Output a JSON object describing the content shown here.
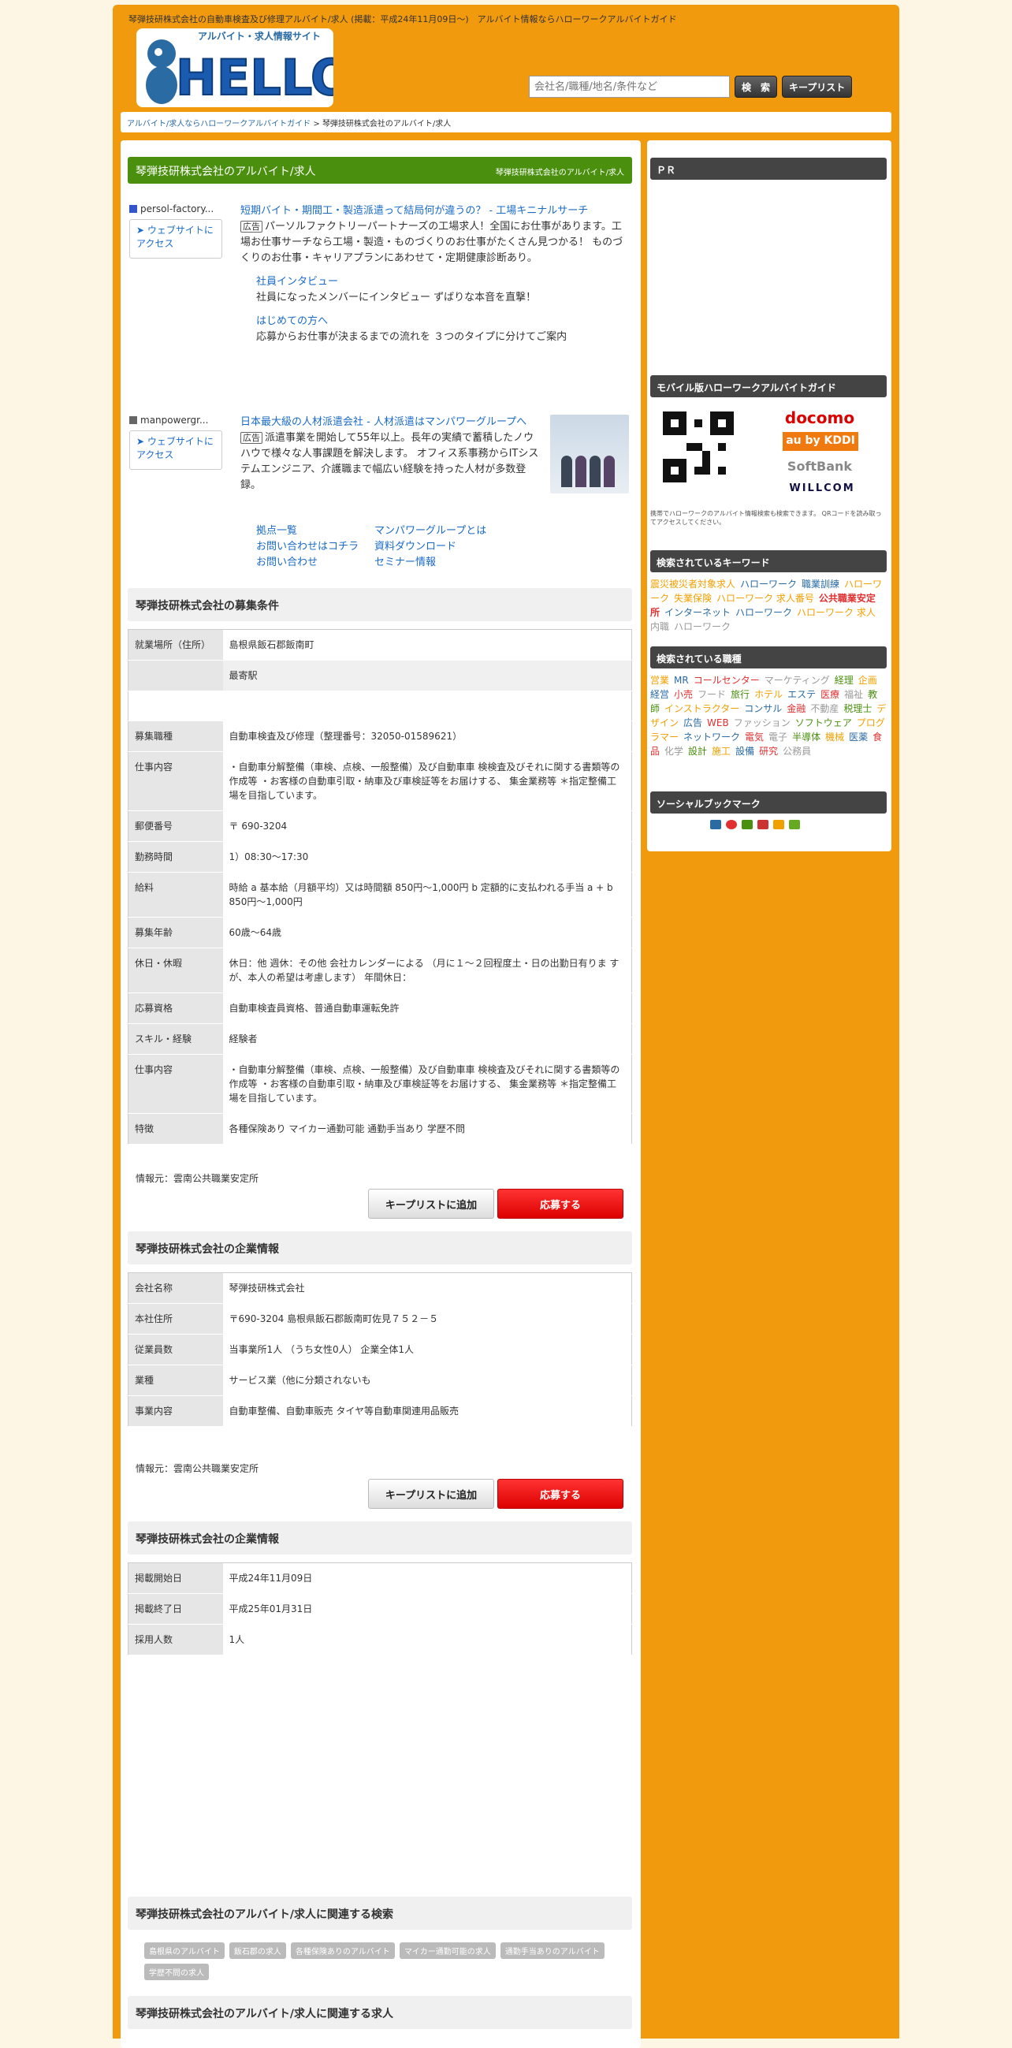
{
  "header": {
    "top_text": "琴弾技研株式会社の自動車検査及び修理アルバイト/求人 (掲載：平成24年11月09日～)　アルバイト情報ならハローワークアルバイトガイド",
    "logo_tagline": "アルバイト・求人情報サイト",
    "logo_text": "HELLO!!",
    "search_placeholder": "会社名/職種/地名/条件など",
    "search_button": "検　索",
    "keeplist_button": "キープリスト"
  },
  "breadcrumb": {
    "home": "アルバイト/求人ならハローワークアルバイトガイド",
    "sep": ">",
    "current": "琴弾技研株式会社のアルバイト/求人"
  },
  "main": {
    "title": "琴弾技研株式会社のアルバイト/求人",
    "title_right": "琴弾技研株式会社のアルバイト/求人",
    "ads": [
      {
        "source": "persol-factory...",
        "visit": "➤ ウェブサイトにアクセス",
        "title": "短期バイト・期間工・製造派遣って結局何が違うの？ - 工場キニナルサーチ",
        "badge": "広告",
        "desc": "パーソルファクトリーパートナーズの工場求人！全国にお仕事があります。工場お仕事サーチなら工場・製造・ものづくりのお仕事がたくさん見つかる！ ものづくりのお仕事・キャリアプランにあわせて・定期健康診断あり。",
        "sub": [
          {
            "link": "社員インタビュー",
            "text": "社員になったメンバーにインタビュー ずばりな本音を直撃！"
          },
          {
            "link": "はじめての方へ",
            "text": "応募からお仕事が決まるまでの流れを ３つのタイプに分けてご案内"
          }
        ]
      },
      {
        "source": "manpowergr...",
        "visit": "➤ ウェブサイトにアクセス",
        "title": "日本最大級の人材派遣会社 - 人材派遣はマンパワーグループへ",
        "badge": "広告",
        "desc": "派遣事業を開始して55年以上。長年の実績で蓄積したノウハウで様々な人事課題を解決します。 オフィス系事務からITシステムエンジニア、介護職まで幅広い経験を持った人材が多数登録。",
        "links": [
          "拠点一覧",
          "マンパワーグループとは",
          "お問い合わせはコチラ",
          "資料ダウンロード",
          "お問い合わせ",
          "セミナー情報"
        ]
      }
    ],
    "recruit": {
      "heading": "琴弾技研株式会社の募集条件",
      "rows": [
        {
          "k": "就業場所（住所）",
          "v": "島根県飯石郡飯南町"
        },
        {
          "k": "",
          "v": "最寄駅"
        },
        {
          "k": "募集職種",
          "v": "自動車検査及び修理（整理番号：32050-01589621）"
        },
        {
          "k": "仕事内容",
          "v": "・自動車分解整備（車検、点検、一般整備）及び自動車車 検検査及びそれに関する書類等の作成等 ・お客様の自動車引取・納車及び車検証等をお届けする、 集金業務等 ＊指定整備工場を目指しています。"
        },
        {
          "k": "郵便番号",
          "v": "〒 690-3204"
        },
        {
          "k": "勤務時間",
          "v": "1）08:30～17:30"
        },
        {
          "k": "給料",
          "v": "時給 a 基本給（月額平均）又は時間額 850円～1,000円 b 定額的に支払われる手当 a + b 850円～1,000円"
        },
        {
          "k": "募集年齢",
          "v": "60歳～64歳"
        },
        {
          "k": "休日・休暇",
          "v": "休日：他 週休：その他 会社カレンダーによる （月に１～２回程度土・日の出勤日有りま すが、本人の希望は考慮します） 年間休日："
        },
        {
          "k": "応募資格",
          "v": "自動車検査員資格、普通自動車運転免許"
        },
        {
          "k": "スキル・経験",
          "v": "経験者"
        },
        {
          "k": "仕事内容",
          "v": "・自動車分解整備（車検、点検、一般整備）及び自動車車 検検査及びそれに関する書類等の作成等 ・お客様の自動車引取・納車及び車検証等をお届けする、 集金業務等 ＊指定整備工場を目指しています。"
        },
        {
          "k": "特徴",
          "v": "各種保険あり マイカー通勤可能 通勤手当あり 学歴不問"
        }
      ],
      "credit": "情報元：雲南公共職業安定所"
    },
    "company": {
      "heading": "琴弾技研株式会社の企業情報",
      "rows": [
        {
          "k": "会社名称",
          "v": "琴弾技研株式会社"
        },
        {
          "k": "本社住所",
          "v": "〒690-3204 島根県飯石郡飯南町佐見７５２－５"
        },
        {
          "k": "従業員数",
          "v": "当事業所1人 （うち女性0人） 企業全体1人"
        },
        {
          "k": "業種",
          "v": "サービス業（他に分類されないも"
        },
        {
          "k": "事業内容",
          "v": "自動車整備、自動車販売 タイヤ等自動車関連用品販売"
        }
      ],
      "credit": "情報元：雲南公共職業安定所"
    },
    "period": {
      "heading": "琴弾技研株式会社の企業情報",
      "rows": [
        {
          "k": "掲載開始日",
          "v": "平成24年11月09日"
        },
        {
          "k": "掲載終了日",
          "v": "平成25年01月31日"
        },
        {
          "k": "採用人数",
          "v": "1人"
        }
      ]
    },
    "keep_button": "キープリストに追加",
    "apply_button": "応募する",
    "related_search": {
      "heading": "琴弾技研株式会社のアルバイト/求人に関連する検索",
      "tags": [
        "島根県のアルバイト",
        "飯石郡の求人",
        "各種保険ありのアルバイト",
        "マイカー通勤可能の求人",
        "通勤手当ありのアルバイト",
        "学歴不問の求人"
      ]
    },
    "related_jobs_heading": "琴弾技研株式会社のアルバイト/求人に関連する求人"
  },
  "sidebar": {
    "pr": "ＰＲ",
    "mobile_heading": "モバイル版ハローワークアルバイトガイド",
    "carriers": [
      "docomo",
      "au by KDDI",
      "SoftBank",
      "WILLCOM"
    ],
    "mobile_note": "携帯でハローワークのアルバイト情報検索も検索できます。 QRコードを読み取ってアクセスしてください。",
    "keywords_heading": "検索されているキーワード",
    "keywords": [
      "震災被災者対象求人",
      "ハローワーク",
      "職業訓練",
      "ハローワーク",
      "失業保険",
      "ハローワーク 求人番号",
      "公共職業安定所",
      "インターネット",
      "ハローワーク",
      "ハローワーク 求人",
      "内職",
      "ハローワーク"
    ],
    "jobs_heading": "検索されている職種",
    "jobs": [
      "営業",
      "MR",
      "コールセンター",
      "マーケティング",
      "経理",
      "企画",
      "経営",
      "小売",
      "フード",
      "旅行",
      "ホテル",
      "エステ",
      "医療",
      "福祉",
      "教師",
      "インストラクター",
      "コンサル",
      "金融",
      "不動産",
      "税理士",
      "デザイン",
      "広告",
      "WEB",
      "ファッション",
      "ソフトウェア",
      "プログラマー",
      "ネットワーク",
      "電気",
      "電子",
      "半導体",
      "機械",
      "医薬",
      "食品",
      "化学",
      "設計",
      "施工",
      "設備",
      "研究",
      "公務員"
    ],
    "social_heading": "ソーシャルブックマーク",
    "colors": [
      "#f0a000",
      "#2a6ba3",
      "#e03030",
      "#999999",
      "#4a900e"
    ]
  }
}
